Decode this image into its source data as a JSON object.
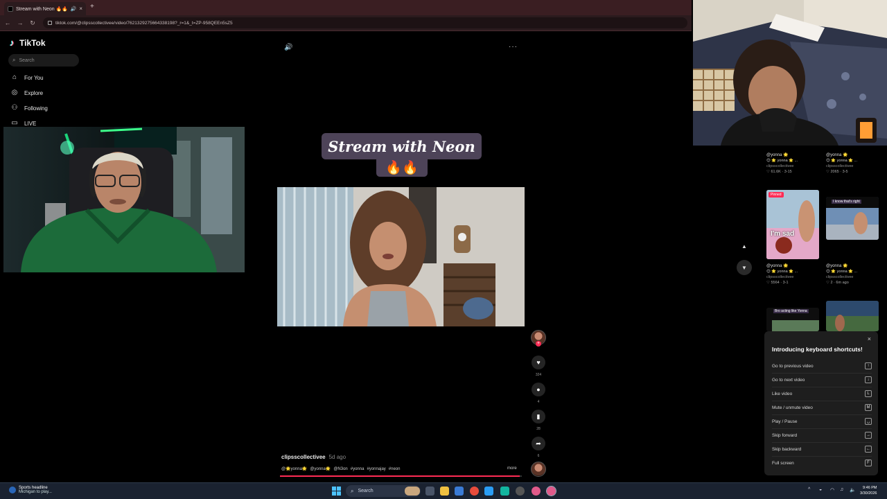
{
  "browser": {
    "tab_title": "Stream with Neon 🔥🔥",
    "tab_close": "×",
    "new_tab": "+",
    "url": "tiktok.com/@clipsscollectivee/video/7621329275664338198?_r=1&_t=ZP-958QEEn5sZ5"
  },
  "sidebar": {
    "logo": "TikTok",
    "search_placeholder": "Search",
    "items": [
      {
        "label": "For You",
        "icon": "home-icon"
      },
      {
        "label": "Explore",
        "icon": "compass-icon"
      },
      {
        "label": "Following",
        "icon": "following-icon"
      },
      {
        "label": "LIVE",
        "icon": "live-icon"
      }
    ]
  },
  "video": {
    "overlay_title": "Stream with Neon",
    "overlay_emoji": "🔥🔥",
    "author": "clipsscollectivee",
    "date": "5d ago",
    "caption_parts": [
      "@🌟yonna🌟",
      "@yonna🌟",
      "@N3on",
      "#yonna",
      "#yonnajay",
      "#neon"
    ],
    "more": "more",
    "progress": 0.99,
    "menu_dots": "···"
  },
  "actions": {
    "likes": "324",
    "comments": "4",
    "saves": "28",
    "shares": "6"
  },
  "grid": [
    {
      "user": "@yonna 🌟",
      "line": "😊 🌟 yonna 🌟 ...",
      "account": "clipsscollectivee",
      "stats": "♡ 61.6K · 3-15"
    },
    {
      "user": "@yonna 🌟",
      "line": "😊 🌟 yonna 🌟 ...",
      "account": "clipsscollectivee",
      "stats": "♡ 2065 · 3-5"
    },
    {
      "user": "@yonna 🌟",
      "line": "😊 🌟 yonna 🌟 ...",
      "account": "clipsscollectivee",
      "stats": "♡ 5564 · 3-1",
      "pinned": "Pinned",
      "thumb_text": "I'm sad"
    },
    {
      "user": "@yonna 🌟",
      "line": "😊 🌟 yonna 🌟 ...",
      "account": "clipsscollectivee",
      "stats": "♡ 2 · 6m ago",
      "thumb_text": "I know that's right"
    },
    {
      "thumb_text": "Bro acting like Yonna"
    },
    {
      "thumb_text": ""
    }
  ],
  "shortcuts": {
    "title": "Introducing keyboard shortcuts!",
    "close": "×",
    "rows": [
      {
        "label": "Go to previous video",
        "key": "↑"
      },
      {
        "label": "Go to next video",
        "key": "↓"
      },
      {
        "label": "Like video",
        "key": "L"
      },
      {
        "label": "Mute / unmute video",
        "key": "M"
      },
      {
        "label": "Play / Pause",
        "key": "␣"
      },
      {
        "label": "Skip forward",
        "key": "→"
      },
      {
        "label": "Skip backward",
        "key": "←"
      },
      {
        "label": "Full screen",
        "key": "F"
      }
    ]
  },
  "taskbar": {
    "news_title": "Sports headline",
    "news_sub": "Michigan to play...",
    "search": "Search",
    "time": "9:46 PM",
    "date": "3/30/2026"
  },
  "colors": {
    "tiktok_red": "#fe2c55",
    "tiktok_cyan": "#25f4ee",
    "overlay_purple": "#4d4358",
    "windows_blue": "#4cc2ff"
  }
}
